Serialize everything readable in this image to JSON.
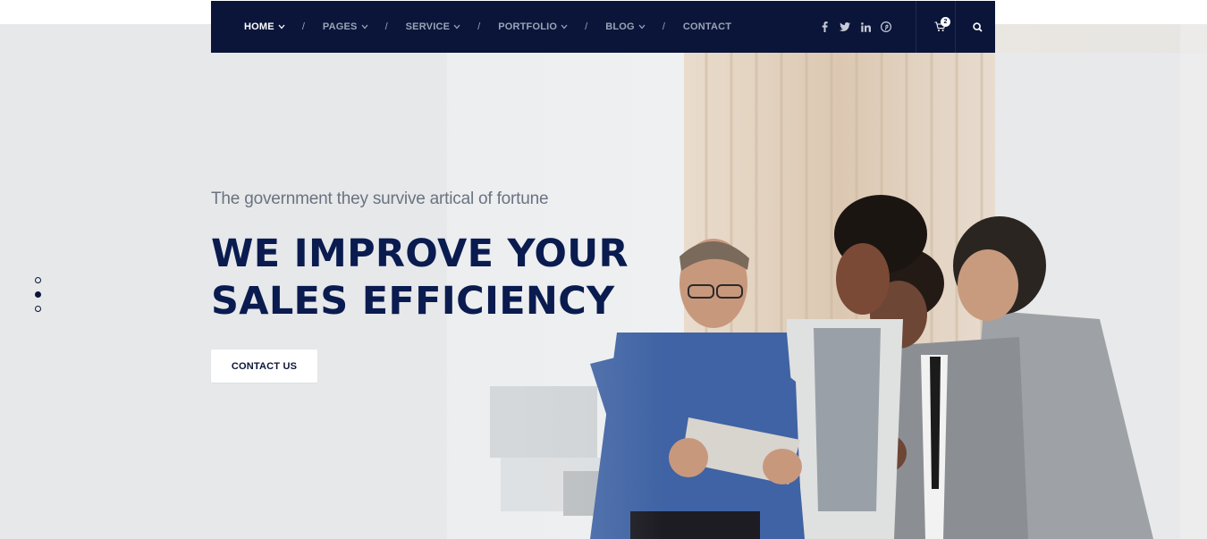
{
  "nav": {
    "items": [
      {
        "label": "HOME",
        "active": true,
        "has_dropdown": true
      },
      {
        "label": "PAGES",
        "active": false,
        "has_dropdown": true
      },
      {
        "label": "SERVICE",
        "active": false,
        "has_dropdown": true
      },
      {
        "label": "PORTFOLIO",
        "active": false,
        "has_dropdown": true
      },
      {
        "label": "BLOG",
        "active": false,
        "has_dropdown": true
      },
      {
        "label": "CONTACT",
        "active": false,
        "has_dropdown": false
      }
    ],
    "separator": "/",
    "socials": [
      "facebook-icon",
      "twitter-icon",
      "linkedin-icon",
      "pinterest-icon"
    ],
    "cart_count": "2",
    "colors": {
      "bar": "#0a1539",
      "active": "#ffffff",
      "inactive": "#9aa3b8"
    }
  },
  "hero": {
    "subtitle": "The government they survive artical of fortune",
    "headline_line1": "WE IMPROVE YOUR",
    "headline_line2": "SALES EFFICIENCY",
    "cta_label": "CONTACT US",
    "slider": {
      "count": 3,
      "active_index": 1
    },
    "colors": {
      "headline": "#0a1b4f",
      "subtitle": "#6b7280"
    }
  }
}
